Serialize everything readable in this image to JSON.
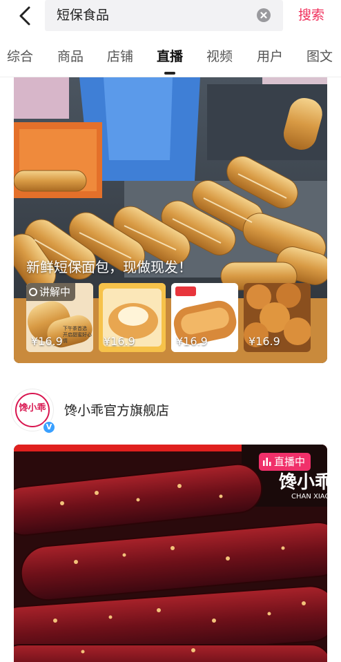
{
  "search": {
    "query": "短保食品",
    "submit_label": "搜索"
  },
  "tabs": [
    {
      "label": "综合"
    },
    {
      "label": "商品"
    },
    {
      "label": "店铺"
    },
    {
      "label": "直播",
      "active": true
    },
    {
      "label": "视频"
    },
    {
      "label": "用户"
    },
    {
      "label": "图文"
    }
  ],
  "live_card_1": {
    "title": "新鲜短保面包，现做现发！",
    "status_badge": "讲解中",
    "products": [
      {
        "price": "¥16.9",
        "caption": "下午茶首选 开启甜蜜好心情"
      },
      {
        "price": "¥16.9"
      },
      {
        "price": "¥16.9"
      },
      {
        "price": "¥16.9"
      }
    ]
  },
  "shop": {
    "avatar_logo": "馋小乖",
    "verified_mark": "V",
    "name": "馋小乖官方旗舰店"
  },
  "live_card_2": {
    "live_badge": "直播中",
    "brand_mark": "馋小乖",
    "brand_sub": "CHAN XIAO"
  },
  "colors": {
    "accent": "#f0305c",
    "live_badge": "#f0306a",
    "verified": "#3aa0ff",
    "brand_red": "#d8154f"
  },
  "icons": {
    "back": "chevron-left-icon",
    "clear": "clear-circle-icon",
    "explain": "live-dot-icon",
    "live": "live-bars-icon"
  }
}
